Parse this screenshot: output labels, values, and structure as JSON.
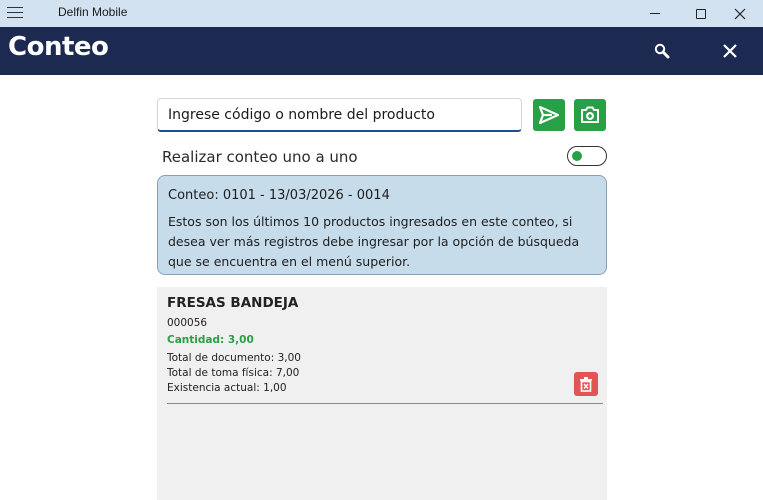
{
  "window": {
    "title": "Delfin Mobile"
  },
  "header": {
    "title": "Conteo"
  },
  "search": {
    "placeholder": "Ingrese código o nombre del producto"
  },
  "toggle": {
    "label": "Realizar conteo uno a uno",
    "on": true
  },
  "info": {
    "title": "Conteo: 0101 - 13/03/2026 - 0014",
    "message": "Estos son los últimos 10 productos ingresados en este conteo, si desea ver más registros debe ingresar por la opción de búsqueda que se encuentra en el menú superior."
  },
  "items": [
    {
      "name": "FRESAS BANDEJA",
      "code": "000056",
      "quantity": "Cantidad: 3,00",
      "total_document": "Total de documento: 3,00",
      "total_physical": "Total de toma física: 7,00",
      "stock": "Existencia actual: 1,00"
    }
  ],
  "colors": {
    "titlebar": "#d3e2f1",
    "appbar": "#1c2950",
    "accent_green": "#27a046",
    "info_panel": "#c7dceb",
    "delete_red": "#e05555"
  }
}
